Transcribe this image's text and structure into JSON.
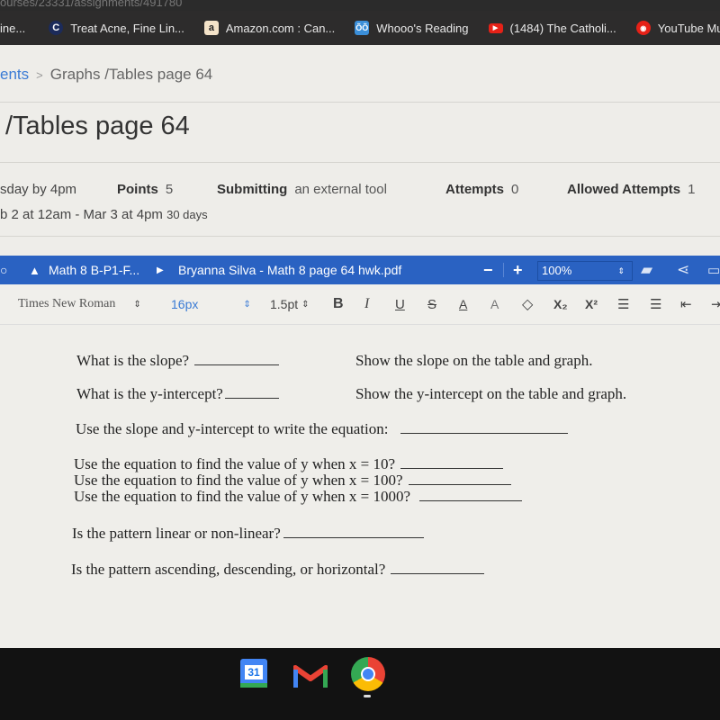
{
  "browser": {
    "url_fragment": "ourses/23331/assignments/491780",
    "bookmarks": [
      {
        "label": "ine...",
        "icon": "bookmark-icon"
      },
      {
        "label": "Treat Acne, Fine Lin...",
        "icon": "skincare-icon"
      },
      {
        "label": "Amazon.com : Can...",
        "icon": "amazon-icon"
      },
      {
        "label": "Whooo's Reading",
        "icon": "owl-icon"
      },
      {
        "label": "(1484) The Catholi...",
        "icon": "youtube-icon"
      },
      {
        "label": "YouTube Music",
        "icon": "youtube-music-icon"
      }
    ]
  },
  "breadcrumb": {
    "parent": "ents",
    "current": "Graphs /Tables page 64"
  },
  "page_title": "/Tables page 64",
  "assignment_meta": {
    "due": "sday by 4pm",
    "points_label": "Points",
    "points_value": "5",
    "submitting_label": "Submitting",
    "submitting_value": "an external tool",
    "attempts_label": "Attempts",
    "attempts_value": "0",
    "allowed_label": "Allowed Attempts",
    "allowed_value": "1",
    "availability": "b 2 at 12am - Mar 3 at 4pm",
    "availability_days": "30 days"
  },
  "viewer": {
    "folder": "Math 8 B-P1-F...",
    "file": "Bryanna Silva - Math 8 page 64 hwk.pdf",
    "zoom_minus": "−",
    "zoom_plus": "+",
    "zoom_value": "100%"
  },
  "format_toolbar": {
    "font": "Times New Roman",
    "size": "16px",
    "stroke": "1.5pt",
    "bold": "B",
    "italic": "I",
    "underline": "U",
    "strike": "S",
    "text_color": "A",
    "highlight": "A",
    "subscript": "X₂",
    "superscript": "X²"
  },
  "worksheet": {
    "q1": "What is the slope?",
    "q1_hint": "Show the slope on the table and  graph.",
    "q2": "What is the y-intercept?",
    "q2_hint": "Show the y-intercept on the table and graph.",
    "q3": "Use the slope and y-intercept to write the equation:",
    "q4": "Use the equation to find the value of  y when x = 10?",
    "q5": "Use the equation to find the value of  y when x = 100?",
    "q6": "Use the equation to find the value of  y when x = 1000?",
    "q7": "Is the pattern linear or non-linear?",
    "q8": "Is the pattern ascending, descending, or horizontal?"
  },
  "taskbar": {
    "calendar_day": "31",
    "apps": [
      "calendar-icon",
      "gmail-icon",
      "chrome-icon"
    ]
  }
}
